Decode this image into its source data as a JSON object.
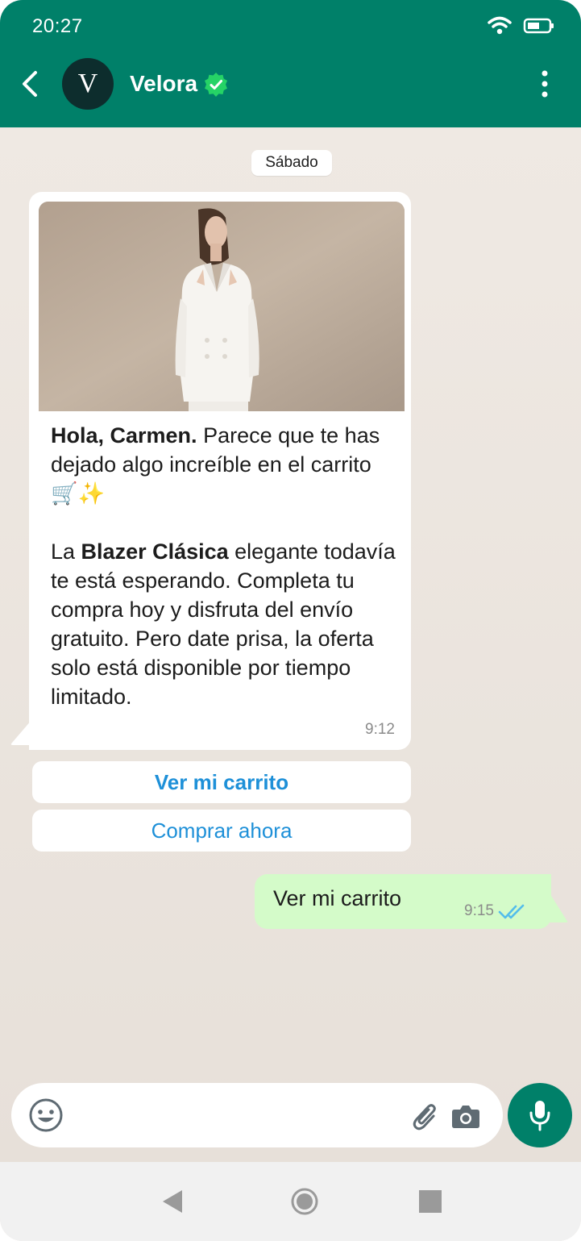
{
  "status_bar": {
    "time": "20:27",
    "icons": [
      "wifi-icon",
      "battery-icon"
    ]
  },
  "header": {
    "title": "Velora",
    "avatar_initial": "V",
    "verified": true,
    "icons": [
      "back-arrow-icon",
      "verified-badge-icon",
      "more-options-icon"
    ]
  },
  "chat": {
    "date_chip": "Sábado",
    "incoming": {
      "image": "product-photo-woman-white-blazer",
      "greeting_bold": "Hola, Carmen.",
      "greeting_rest": " Parece que te has dejado algo increíble en el carrito 🛒✨",
      "body_start": "La ",
      "body_bold": "Blazer Clásica",
      "body_rest": " elegante todavía te está esperando. Completa tu compra hoy y disfruta del envío gratuito. Pero date prisa, la oferta solo está disponible por tiempo limitado.",
      "time": "9:12"
    },
    "quick_replies": [
      "Ver mi carrito",
      "Comprar ahora"
    ],
    "outgoing": {
      "text": "Ver mi carrito",
      "time": "9:15",
      "read": true
    }
  },
  "input_bar": {
    "icons": [
      "emoji-icon",
      "paperclip-icon",
      "camera-icon",
      "microphone-icon"
    ]
  },
  "nav_bar": {
    "icons": [
      "nav-back-icon",
      "nav-home-icon",
      "nav-recents-icon"
    ]
  },
  "colors": {
    "header": "#008069",
    "chat_bg": "#ece5dd",
    "outgoing_bubble": "#d4fbc9",
    "link_blue": "#1e90d8",
    "ticks": "#53bdeb",
    "verified": "#25d366"
  }
}
